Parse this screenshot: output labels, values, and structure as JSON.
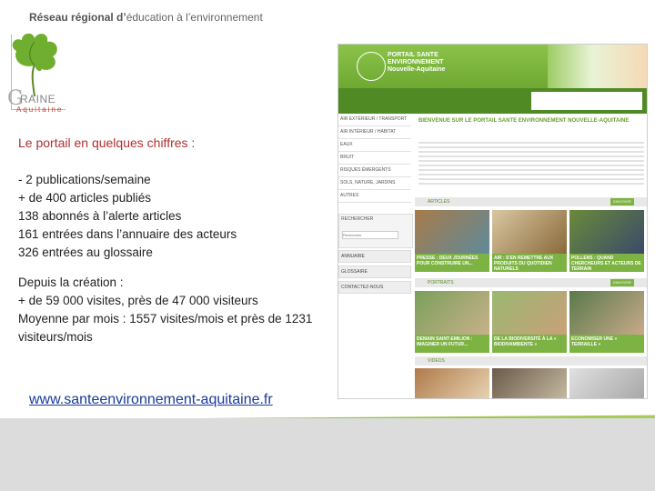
{
  "header": {
    "network_bold": "Réseau régional d’",
    "network_rest": "éducation à l’environnement"
  },
  "logo": {
    "letter": "G",
    "word": "RAINE",
    "region": "Aquitaine"
  },
  "main": {
    "heading": "Le portail en quelques chiffres :",
    "stats": [
      "- 2 publications/semaine",
      "+ de 400 articles publiés",
      "138 abonnés à l’alerte articles",
      "161 entrées dans l’annuaire des acteurs",
      "326 entrées au glossaire"
    ],
    "since": [
      "Depuis la création :",
      "+ de 59 000 visites, près de 47 000 visiteurs",
      "Moyenne par mois : 1557 visites/mois et près de 1231 visiteurs/mois"
    ],
    "link": "www.santeenvironnement-aquitaine.fr"
  },
  "site": {
    "title": "PORTAIL SANTE ENVIRONNEMENT Nouvelle-Aquitaine",
    "nav": [
      "AIR EXTÉRIEUR / TRANSPORT",
      "AIR INTÉRIEUR / HABITAT",
      "EAUX",
      "BRUIT",
      "RISQUES ÉMERGENTS",
      "SOLS, NATURE, JARDINS",
      "AUTRES"
    ],
    "search_label": "RECHERCHER",
    "search_placeholder": "Rechercher",
    "side_buttons": [
      "ANNUAIRE",
      "GLOSSAIRE",
      "CONTACTEZ-NOUS"
    ],
    "welcome": "BIENVENUE SUR LE PORTAIL SANTE ENVIRONNEMENT NOUVELLE-AQUITAINE",
    "sections": [
      "ARTICLES",
      "PORTRAITS",
      "VIDEOS"
    ],
    "envoi": "ENVOYER",
    "article_caps": [
      "PRESSE : DEUX JOURNÉES POUR CONSTRUIRE UN...",
      "AIR : S'EN REMETTRE AUX PRODUITS DU QUOTIDIEN NATURELS",
      "POLLENS : QUAND CHERCHEURS ET ACTEURS DE TERRAIN"
    ],
    "portrait_caps": [
      "DEMAIN SAINT-EMILION : IMAGINER UN FUTUR...",
      "DE LA BIODIVERSITÉ À LA « BIODIVAMBIENTE »",
      "ECONOMISER UNE « TERRAILLE »"
    ]
  }
}
